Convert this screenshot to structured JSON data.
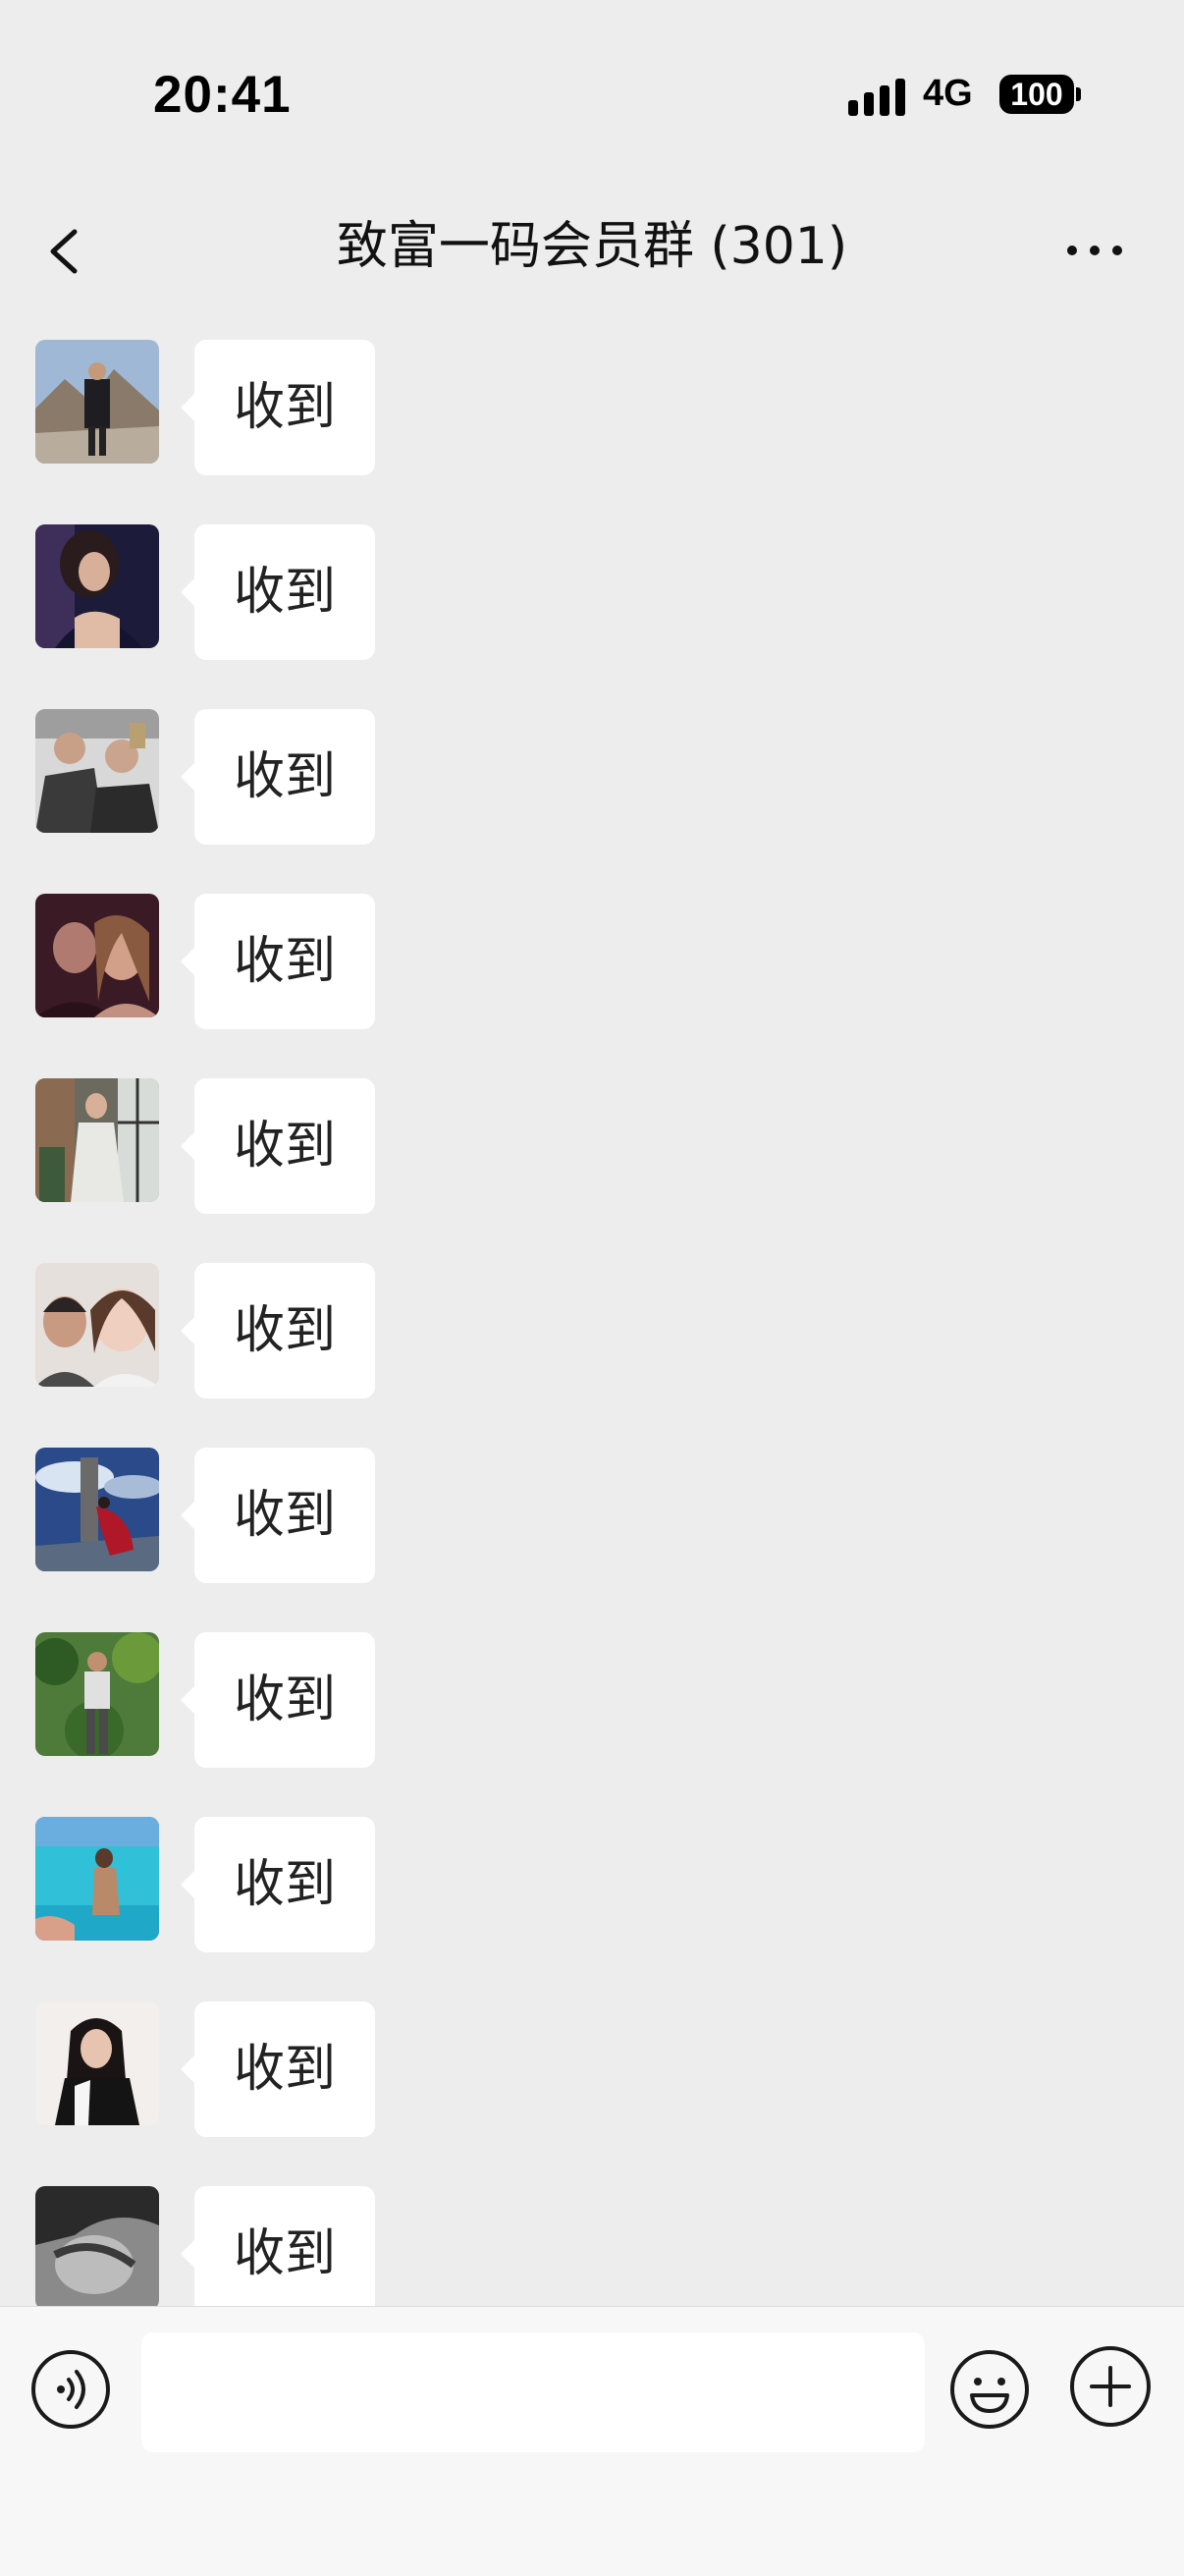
{
  "status_bar": {
    "time": "20:41",
    "network": "4G",
    "battery": "100"
  },
  "header": {
    "title": "致富一码会员群 (301)",
    "back_icon": "chevron-left-icon",
    "more_icon": "ellipsis-icon"
  },
  "messages": [
    {
      "text": "收到",
      "avatar": "avatar-mountain-man"
    },
    {
      "text": "收到",
      "avatar": "avatar-woman-dark"
    },
    {
      "text": "收到",
      "avatar": "avatar-two-men-selfie"
    },
    {
      "text": "收到",
      "avatar": "avatar-couple-dark"
    },
    {
      "text": "收到",
      "avatar": "avatar-woman-white-dress"
    },
    {
      "text": "收到",
      "avatar": "avatar-couple-bright"
    },
    {
      "text": "收到",
      "avatar": "avatar-statue-red-scarf"
    },
    {
      "text": "收到",
      "avatar": "avatar-man-garden"
    },
    {
      "text": "收到",
      "avatar": "avatar-woman-sea"
    },
    {
      "text": "收到",
      "avatar": "avatar-woman-black"
    },
    {
      "text": "收到",
      "avatar": "avatar-bw-portrait"
    }
  ],
  "input_bar": {
    "voice_icon": "voice-icon",
    "input_placeholder": "",
    "emoji_icon": "emoji-icon",
    "plus_icon": "plus-icon"
  }
}
